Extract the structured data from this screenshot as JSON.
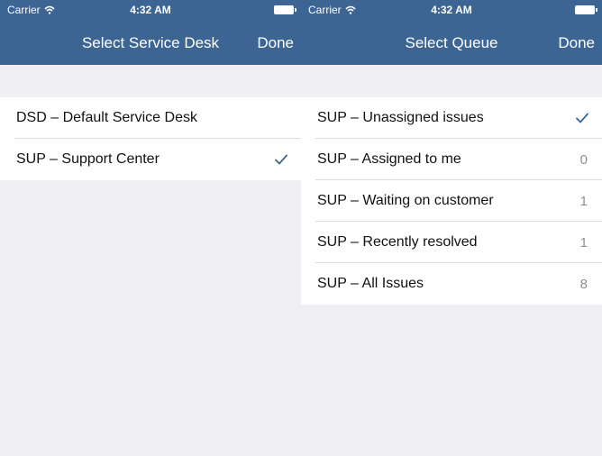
{
  "left": {
    "status": {
      "carrier": "Carrier",
      "time": "4:32 AM"
    },
    "nav": {
      "title": "Select Service Desk",
      "done_label": "Done"
    },
    "rows": [
      {
        "label": "DSD – Default Service Desk",
        "checked": false
      },
      {
        "label": "SUP – Support Center",
        "checked": true
      }
    ]
  },
  "right": {
    "status": {
      "carrier": "Carrier",
      "time": "4:32 AM"
    },
    "nav": {
      "title": "Select Queue",
      "done_label": "Done"
    },
    "rows": [
      {
        "label": "SUP – Unassigned issues",
        "checked": true,
        "count": ""
      },
      {
        "label": "SUP – Assigned to me",
        "checked": false,
        "count": "0"
      },
      {
        "label": "SUP – Waiting on customer",
        "checked": false,
        "count": "1"
      },
      {
        "label": "SUP – Recently resolved",
        "checked": false,
        "count": "1"
      },
      {
        "label": "SUP – All Issues",
        "checked": false,
        "count": "8"
      }
    ]
  },
  "colors": {
    "nav_bg": "#3c6593",
    "accent": "#3c6593",
    "background": "#efeff4"
  },
  "icons": {
    "check": "checkmark-icon",
    "wifi": "wifi-icon",
    "battery": "battery-icon"
  }
}
